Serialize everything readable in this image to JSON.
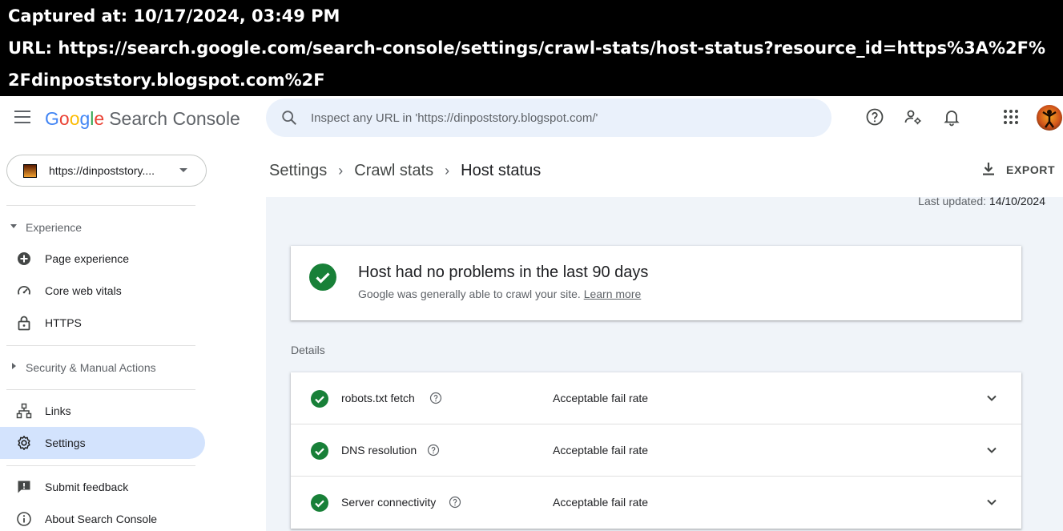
{
  "capture": {
    "captured_at": "Captured at: 10/17/2024, 03:49 PM",
    "url": "URL: https://search.google.com/search-console/settings/crawl-stats/host-status?resource_id=https%3A%2F%2Fdinpoststory.blogspot.com%2F"
  },
  "header": {
    "logo": {
      "g": "G",
      "o1": "o",
      "o2": "o",
      "g2": "g",
      "l": "l",
      "e": "e",
      "product": "Search Console"
    },
    "search_placeholder": "Inspect any URL in 'https://dinpoststory.blogspot.com/'",
    "icons": [
      "menu-icon",
      "search-icon",
      "help-icon",
      "manage-users-icon",
      "notifications-icon",
      "apps-grid-icon",
      "account-avatar"
    ]
  },
  "sidebar": {
    "property_label": "https://dinpoststory....",
    "sections": {
      "experience": "Experience",
      "security": "Security & Manual Actions"
    },
    "experience_items": [
      {
        "label": "Page experience",
        "icon": "plus-circle-icon"
      },
      {
        "label": "Core web vitals",
        "icon": "speedometer-icon"
      },
      {
        "label": "HTTPS",
        "icon": "lock-icon"
      }
    ],
    "items": {
      "links": "Links",
      "settings": "Settings",
      "feedback": "Submit feedback",
      "about": "About Search Console"
    }
  },
  "main": {
    "breadcrumb": [
      "Settings",
      "Crawl stats",
      "Host status"
    ],
    "export_label": "EXPORT",
    "last_updated_label": "Last updated: ",
    "last_updated_date": "14/10/2024",
    "status": {
      "title": "Host had no problems in the last 90 days",
      "subtitle": "Google was generally able to crawl your site. ",
      "learn_more": "Learn more"
    },
    "details_label": "Details",
    "details": [
      {
        "name": "robots.txt fetch",
        "status": "Acceptable fail rate"
      },
      {
        "name": "DNS resolution",
        "status": "Acceptable fail rate"
      },
      {
        "name": "Server connectivity",
        "status": "Acceptable fail rate"
      }
    ]
  },
  "colors": {
    "accent_green": "#188038",
    "active_nav": "#d3e3fd",
    "search_bg": "#eaf1fb",
    "content_bg": "#f0f4f9"
  }
}
